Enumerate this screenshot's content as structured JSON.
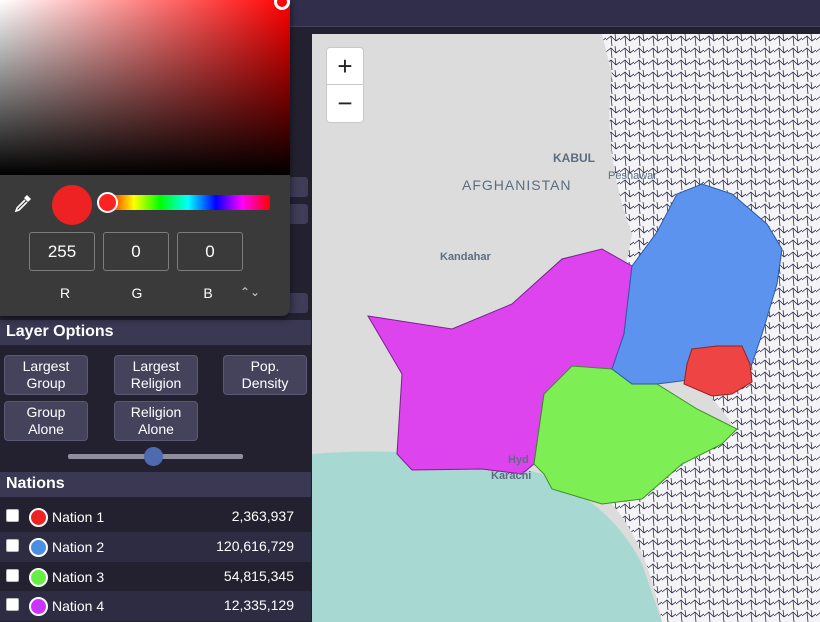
{
  "layer_options": {
    "title": "Layer Options",
    "buttons": [
      "Largest\nGroup",
      "Largest\nReligion",
      "Pop.\nDensity",
      "Group\nAlone",
      "Religion\nAlone"
    ],
    "opacity_slider_value_fraction": 0.49
  },
  "nations": {
    "title": "Nations",
    "rows": [
      {
        "name": "Nation 1",
        "population": "2,363,937",
        "color": "#ee2222",
        "checked": false
      },
      {
        "name": "Nation 2",
        "population": "120,616,729",
        "color": "#4a90e2",
        "checked": false
      },
      {
        "name": "Nation 3",
        "population": "54,815,345",
        "color": "#66ee44",
        "checked": false
      },
      {
        "name": "Nation 4",
        "population": "12,335,129",
        "color": "#cc33ff",
        "checked": false
      }
    ]
  },
  "color_picker": {
    "current_color": "#ee2222",
    "r": "255",
    "g": "0",
    "b": "0",
    "labels": {
      "r": "R",
      "g": "G",
      "b": "B"
    },
    "eyedropper_icon": "eyedropper-icon",
    "mode_toggle_icon": "updown-chevron-icon"
  },
  "map": {
    "zoom_in_label": "+",
    "zoom_out_label": "−",
    "labels": {
      "kabul": "KABUL",
      "afghanistan": "AFGHANISTAN",
      "peshawar": "Peshawar",
      "kandahar": "Kandahar",
      "karachi": "Karachi",
      "hyderabad": "Hyd"
    },
    "region_colors": {
      "nation1": "#ee4444",
      "nation2": "#5b93ee",
      "nation3": "#7eee55",
      "nation4": "#dd44ee",
      "sea": "#a8d8d2",
      "land": "#dcdcdc",
      "borders": "#2b2a4a"
    }
  }
}
